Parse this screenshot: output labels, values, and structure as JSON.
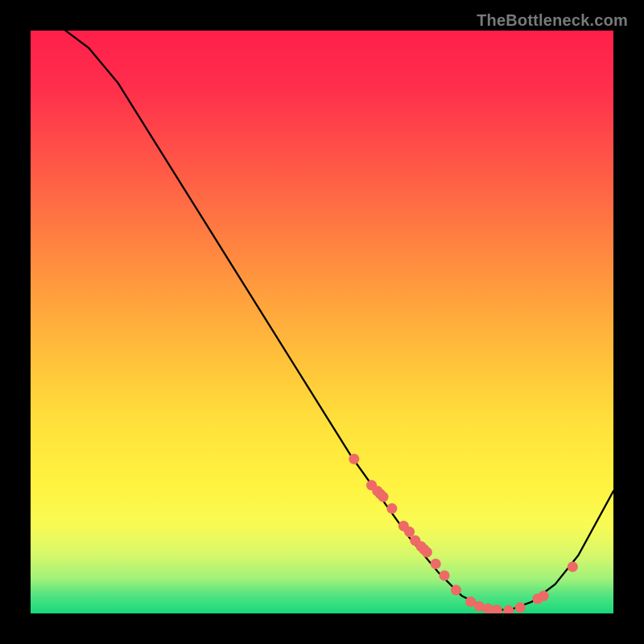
{
  "watermark": "TheBottleneck.com",
  "chart_data": {
    "type": "line",
    "title": "",
    "xlabel": "",
    "ylabel": "",
    "xlim": [
      0,
      100
    ],
    "ylim": [
      0,
      100
    ],
    "curve": {
      "x": [
        6,
        10,
        15,
        20,
        25,
        30,
        35,
        40,
        45,
        50,
        55,
        60,
        65,
        70,
        74,
        78,
        82,
        86,
        90,
        94,
        100
      ],
      "y": [
        100,
        97,
        91,
        83,
        75,
        67,
        59,
        51,
        43,
        35,
        27,
        20,
        13,
        7,
        3,
        1,
        0.5,
        2,
        5,
        10,
        21
      ]
    },
    "markers": {
      "x": [
        55.5,
        58.5,
        59.5,
        60,
        60.5,
        62,
        64,
        65,
        66,
        67,
        67.5,
        68,
        69.5,
        71,
        73,
        75.5,
        77,
        78.5,
        80,
        82,
        84,
        87,
        88,
        93
      ],
      "y": [
        26.5,
        22,
        21,
        20.5,
        20,
        18,
        15,
        14,
        12.5,
        11.5,
        11,
        10.5,
        8.5,
        6.5,
        4,
        2,
        1.2,
        0.8,
        0.6,
        0.5,
        1,
        2.5,
        3,
        8
      ]
    },
    "colors": {
      "line": "#000000",
      "marker": "#ed6a66"
    }
  }
}
